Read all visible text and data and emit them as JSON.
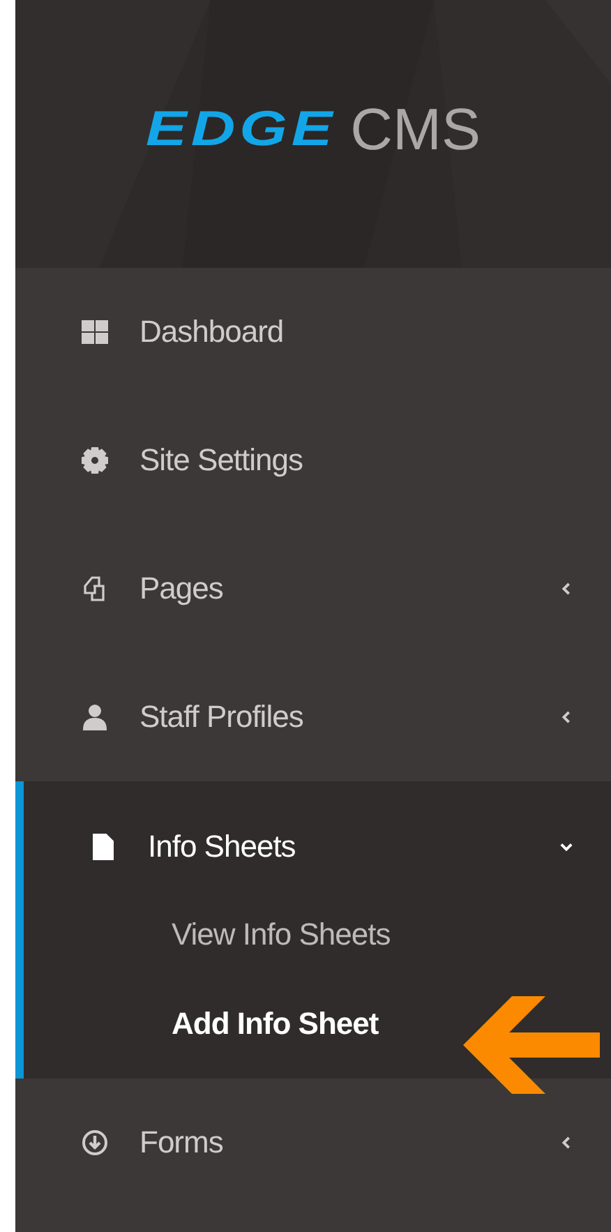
{
  "logo": {
    "brand": "EDGE",
    "product": "CMS"
  },
  "menu": [
    {
      "label": "Dashboard",
      "selected": false
    },
    {
      "label": "Site Settings",
      "selected": false
    },
    {
      "label": "Pages",
      "selected": false,
      "expanded": false
    },
    {
      "label": "Staff Profiles",
      "selected": false,
      "expanded": false
    },
    {
      "label": "Info Sheets",
      "selected": true,
      "expanded": true,
      "children": [
        {
          "label": "View Info Sheets",
          "selected": false
        },
        {
          "label": "Add Info Sheet",
          "selected": true
        }
      ]
    },
    {
      "label": "Forms",
      "selected": false,
      "expanded": false
    }
  ]
}
